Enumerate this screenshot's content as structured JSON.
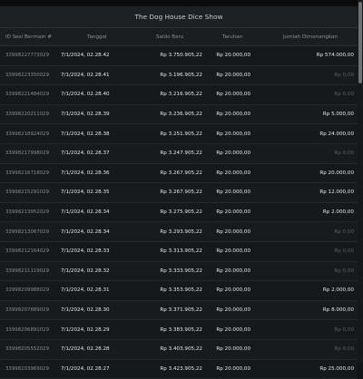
{
  "title": "The Dog House Dice Show",
  "columns": {
    "id": "ID Sesi Bermain #",
    "date": "Tanggal",
    "saldo": "Saldo Baru",
    "bet": "Taruhan",
    "win": "Jumlah Dimenangkan"
  },
  "rows": [
    {
      "id": "33998227773029",
      "date": "7/1/2024, 02.28.42",
      "saldo": "Rp 3.750.905,22",
      "bet": "Rp 20.000,00",
      "win": "Rp 574.000,00",
      "zero": false
    },
    {
      "id": "33998223350029",
      "date": "7/1/2024, 02.28.41",
      "saldo": "Rp 3.196.905,22",
      "bet": "Rp 20.000,00",
      "win": "Rp 0,00",
      "zero": true
    },
    {
      "id": "33998221484029",
      "date": "7/1/2024, 02.28.40",
      "saldo": "Rp 3.216.905,22",
      "bet": "Rp 20.000,00",
      "win": "Rp 0,00",
      "zero": true
    },
    {
      "id": "33998220211029",
      "date": "7/1/2024, 02.28.39",
      "saldo": "Rp 3.236.905,22",
      "bet": "Rp 20.000,00",
      "win": "Rp 5.000,00",
      "zero": false
    },
    {
      "id": "33998218924029",
      "date": "7/1/2024, 02.28.38",
      "saldo": "Rp 3.251.905,22",
      "bet": "Rp 20.000,00",
      "win": "Rp 24.000,00",
      "zero": false
    },
    {
      "id": "33998217998029",
      "date": "7/1/2024, 02.28.37",
      "saldo": "Rp 3.247.905,22",
      "bet": "Rp 20.000,00",
      "win": "Rp 0,00",
      "zero": true
    },
    {
      "id": "33998216718029",
      "date": "7/1/2024, 02.28.36",
      "saldo": "Rp 3.267.905,22",
      "bet": "Rp 20.000,00",
      "win": "Rp 20.000,00",
      "zero": false
    },
    {
      "id": "33998215291029",
      "date": "7/1/2024, 02.28.35",
      "saldo": "Rp 3.267.905,22",
      "bet": "Rp 20.000,00",
      "win": "Rp 12.000,00",
      "zero": false
    },
    {
      "id": "33998213952029",
      "date": "7/1/2024, 02.28.34",
      "saldo": "Rp 3.275.905,22",
      "bet": "Rp 20.000,00",
      "win": "Rp 2.000,00",
      "zero": false
    },
    {
      "id": "33998213067029",
      "date": "7/1/2024, 02.28.34",
      "saldo": "Rp 3.293.905,22",
      "bet": "Rp 20.000,00",
      "win": "Rp 0,00",
      "zero": true
    },
    {
      "id": "33998212164029",
      "date": "7/1/2024, 02.28.33",
      "saldo": "Rp 3.313.905,22",
      "bet": "Rp 20.000,00",
      "win": "Rp 0,00",
      "zero": true
    },
    {
      "id": "33998211119029",
      "date": "7/1/2024, 02.28.32",
      "saldo": "Rp 3.333.905,22",
      "bet": "Rp 20.000,00",
      "win": "Rp 0,00",
      "zero": true
    },
    {
      "id": "33998209988029",
      "date": "7/1/2024, 02.28.31",
      "saldo": "Rp 3.353.905,22",
      "bet": "Rp 20.000,00",
      "win": "Rp 2.000,00",
      "zero": false
    },
    {
      "id": "33998207889029",
      "date": "7/1/2024, 02.28.30",
      "saldo": "Rp 3.371.905,22",
      "bet": "Rp 20.000,00",
      "win": "Rp 8.000,00",
      "zero": false
    },
    {
      "id": "33998206891029",
      "date": "7/1/2024, 02.28.29",
      "saldo": "Rp 3.383.905,22",
      "bet": "Rp 20.000,00",
      "win": "Rp 0,00",
      "zero": true
    },
    {
      "id": "33998205552029",
      "date": "7/1/2024, 02.28.28",
      "saldo": "Rp 3.403.905,22",
      "bet": "Rp 20.000,00",
      "win": "Rp 0,00",
      "zero": true
    },
    {
      "id": "33998203969029",
      "date": "7/1/2024, 02.28.27",
      "saldo": "Rp 3.423.905,22",
      "bet": "Rp 20.000,00",
      "win": "Rp 25.000,00",
      "zero": false
    }
  ]
}
